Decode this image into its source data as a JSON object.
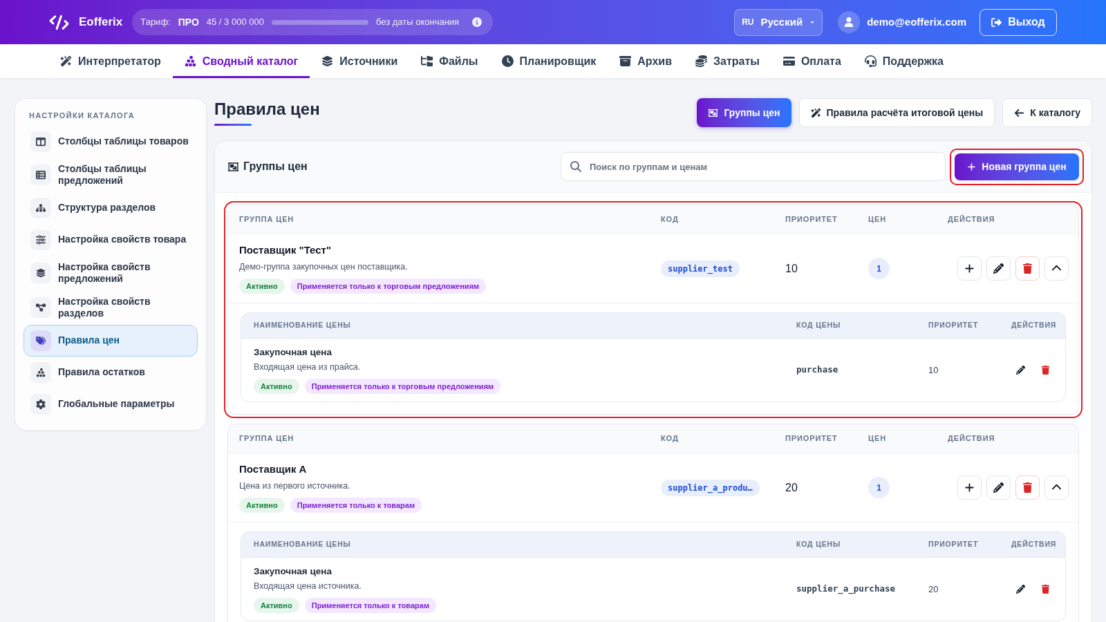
{
  "header": {
    "brand": "Eofferix",
    "tariff": {
      "label": "Тариф:",
      "plan": "ПРО",
      "usage": "45 / 3 000 000",
      "expiry": "без даты окончания"
    },
    "language": {
      "code": "RU",
      "name": "Русский"
    },
    "user": {
      "email": "demo@eofferix.com"
    },
    "logout": {
      "label": "Выход"
    }
  },
  "nav": [
    {
      "label": "Интерпретатор",
      "selected": false
    },
    {
      "label": "Сводный каталог",
      "selected": true
    },
    {
      "label": "Источники",
      "selected": false
    },
    {
      "label": "Файлы",
      "selected": false
    },
    {
      "label": "Планировщик",
      "selected": false
    },
    {
      "label": "Архив",
      "selected": false
    },
    {
      "label": "Затраты",
      "selected": false
    },
    {
      "label": "Оплата",
      "selected": false
    },
    {
      "label": "Поддержка",
      "selected": false
    }
  ],
  "sidebar": {
    "title": "НАСТРОЙКИ КАТАЛОГА",
    "items": [
      {
        "label": "Столбцы таблицы товаров",
        "selected": false
      },
      {
        "label": "Столбцы таблицы предложений",
        "selected": false
      },
      {
        "label": "Структура разделов",
        "selected": false
      },
      {
        "label": "Настройка свойств товара",
        "selected": false
      },
      {
        "label": "Настройка свойств предложений",
        "selected": false
      },
      {
        "label": "Настройка свойств разделов",
        "selected": false
      },
      {
        "label": "Правила цен",
        "selected": true
      },
      {
        "label": "Правила остатков",
        "selected": false
      },
      {
        "label": "Глобальные параметры",
        "selected": false
      }
    ]
  },
  "page": {
    "title": "Правила цен",
    "actions": [
      {
        "label": "Группы цен",
        "selected": true
      },
      {
        "label": "Правила расчёта итоговой цены",
        "selected": false
      },
      {
        "label": "К каталогу",
        "selected": false
      }
    ]
  },
  "panel": {
    "title": "Группы цен",
    "search": {
      "placeholder": "Поиск по группам и ценам"
    },
    "new_group_button": {
      "label": "Новая группа цен",
      "highlighted": true
    },
    "groups": [
      {
        "highlighted": true,
        "expanded": true,
        "columns": [
          "ГРУППА ЦЕН",
          "КОД",
          "ПРИОРИТЕТ",
          "ЦЕН",
          "ДЕЙСТВИЯ"
        ],
        "name": "Поставщик \"Тест\"",
        "description": "Демо-группа закупочных цен поставщика.",
        "badges": [
          {
            "label": "Активно",
            "kind": "status"
          },
          {
            "label": "Применяется только к торговым предложениям",
            "kind": "scope"
          }
        ],
        "code": "supplier_test",
        "priority": "10",
        "price_count": "1",
        "prices": {
          "columns": [
            "НАИМЕНОВАНИЕ ЦЕНЫ",
            "КОД ЦЕНЫ",
            "ПРИОРИТЕТ",
            "ДЕЙСТВИЯ"
          ],
          "rows": [
            {
              "name": "Закупочная цена",
              "description": "Входящая цена из прайса.",
              "badges": [
                {
                  "label": "Активно",
                  "kind": "status"
                },
                {
                  "label": "Применяется только к торговым предложениям",
                  "kind": "scope"
                }
              ],
              "code": "purchase",
              "priority": "10"
            }
          ]
        }
      },
      {
        "highlighted": false,
        "expanded": true,
        "columns": [
          "ГРУППА ЦЕН",
          "КОД",
          "ПРИОРИТЕТ",
          "ЦЕН",
          "ДЕЙСТВИЯ"
        ],
        "name": "Поставщик А",
        "description": "Цена из первого источника.",
        "badges": [
          {
            "label": "Активно",
            "kind": "status"
          },
          {
            "label": "Применяется только к товарам",
            "kind": "scope"
          }
        ],
        "code": "supplier_a_produ…",
        "priority": "20",
        "price_count": "1",
        "prices": {
          "columns": [
            "НАИМЕНОВАНИЕ ЦЕНЫ",
            "КОД ЦЕНЫ",
            "ПРИОРИТЕТ",
            "ДЕЙСТВИЯ"
          ],
          "rows": [
            {
              "name": "Закупочная цена",
              "description": "Входящая цена источника.",
              "badges": [
                {
                  "label": "Активно",
                  "kind": "status"
                },
                {
                  "label": "Применяется только к товарам",
                  "kind": "scope"
                }
              ],
              "code": "supplier_a_purchase",
              "priority": "20"
            }
          ]
        }
      }
    ]
  }
}
